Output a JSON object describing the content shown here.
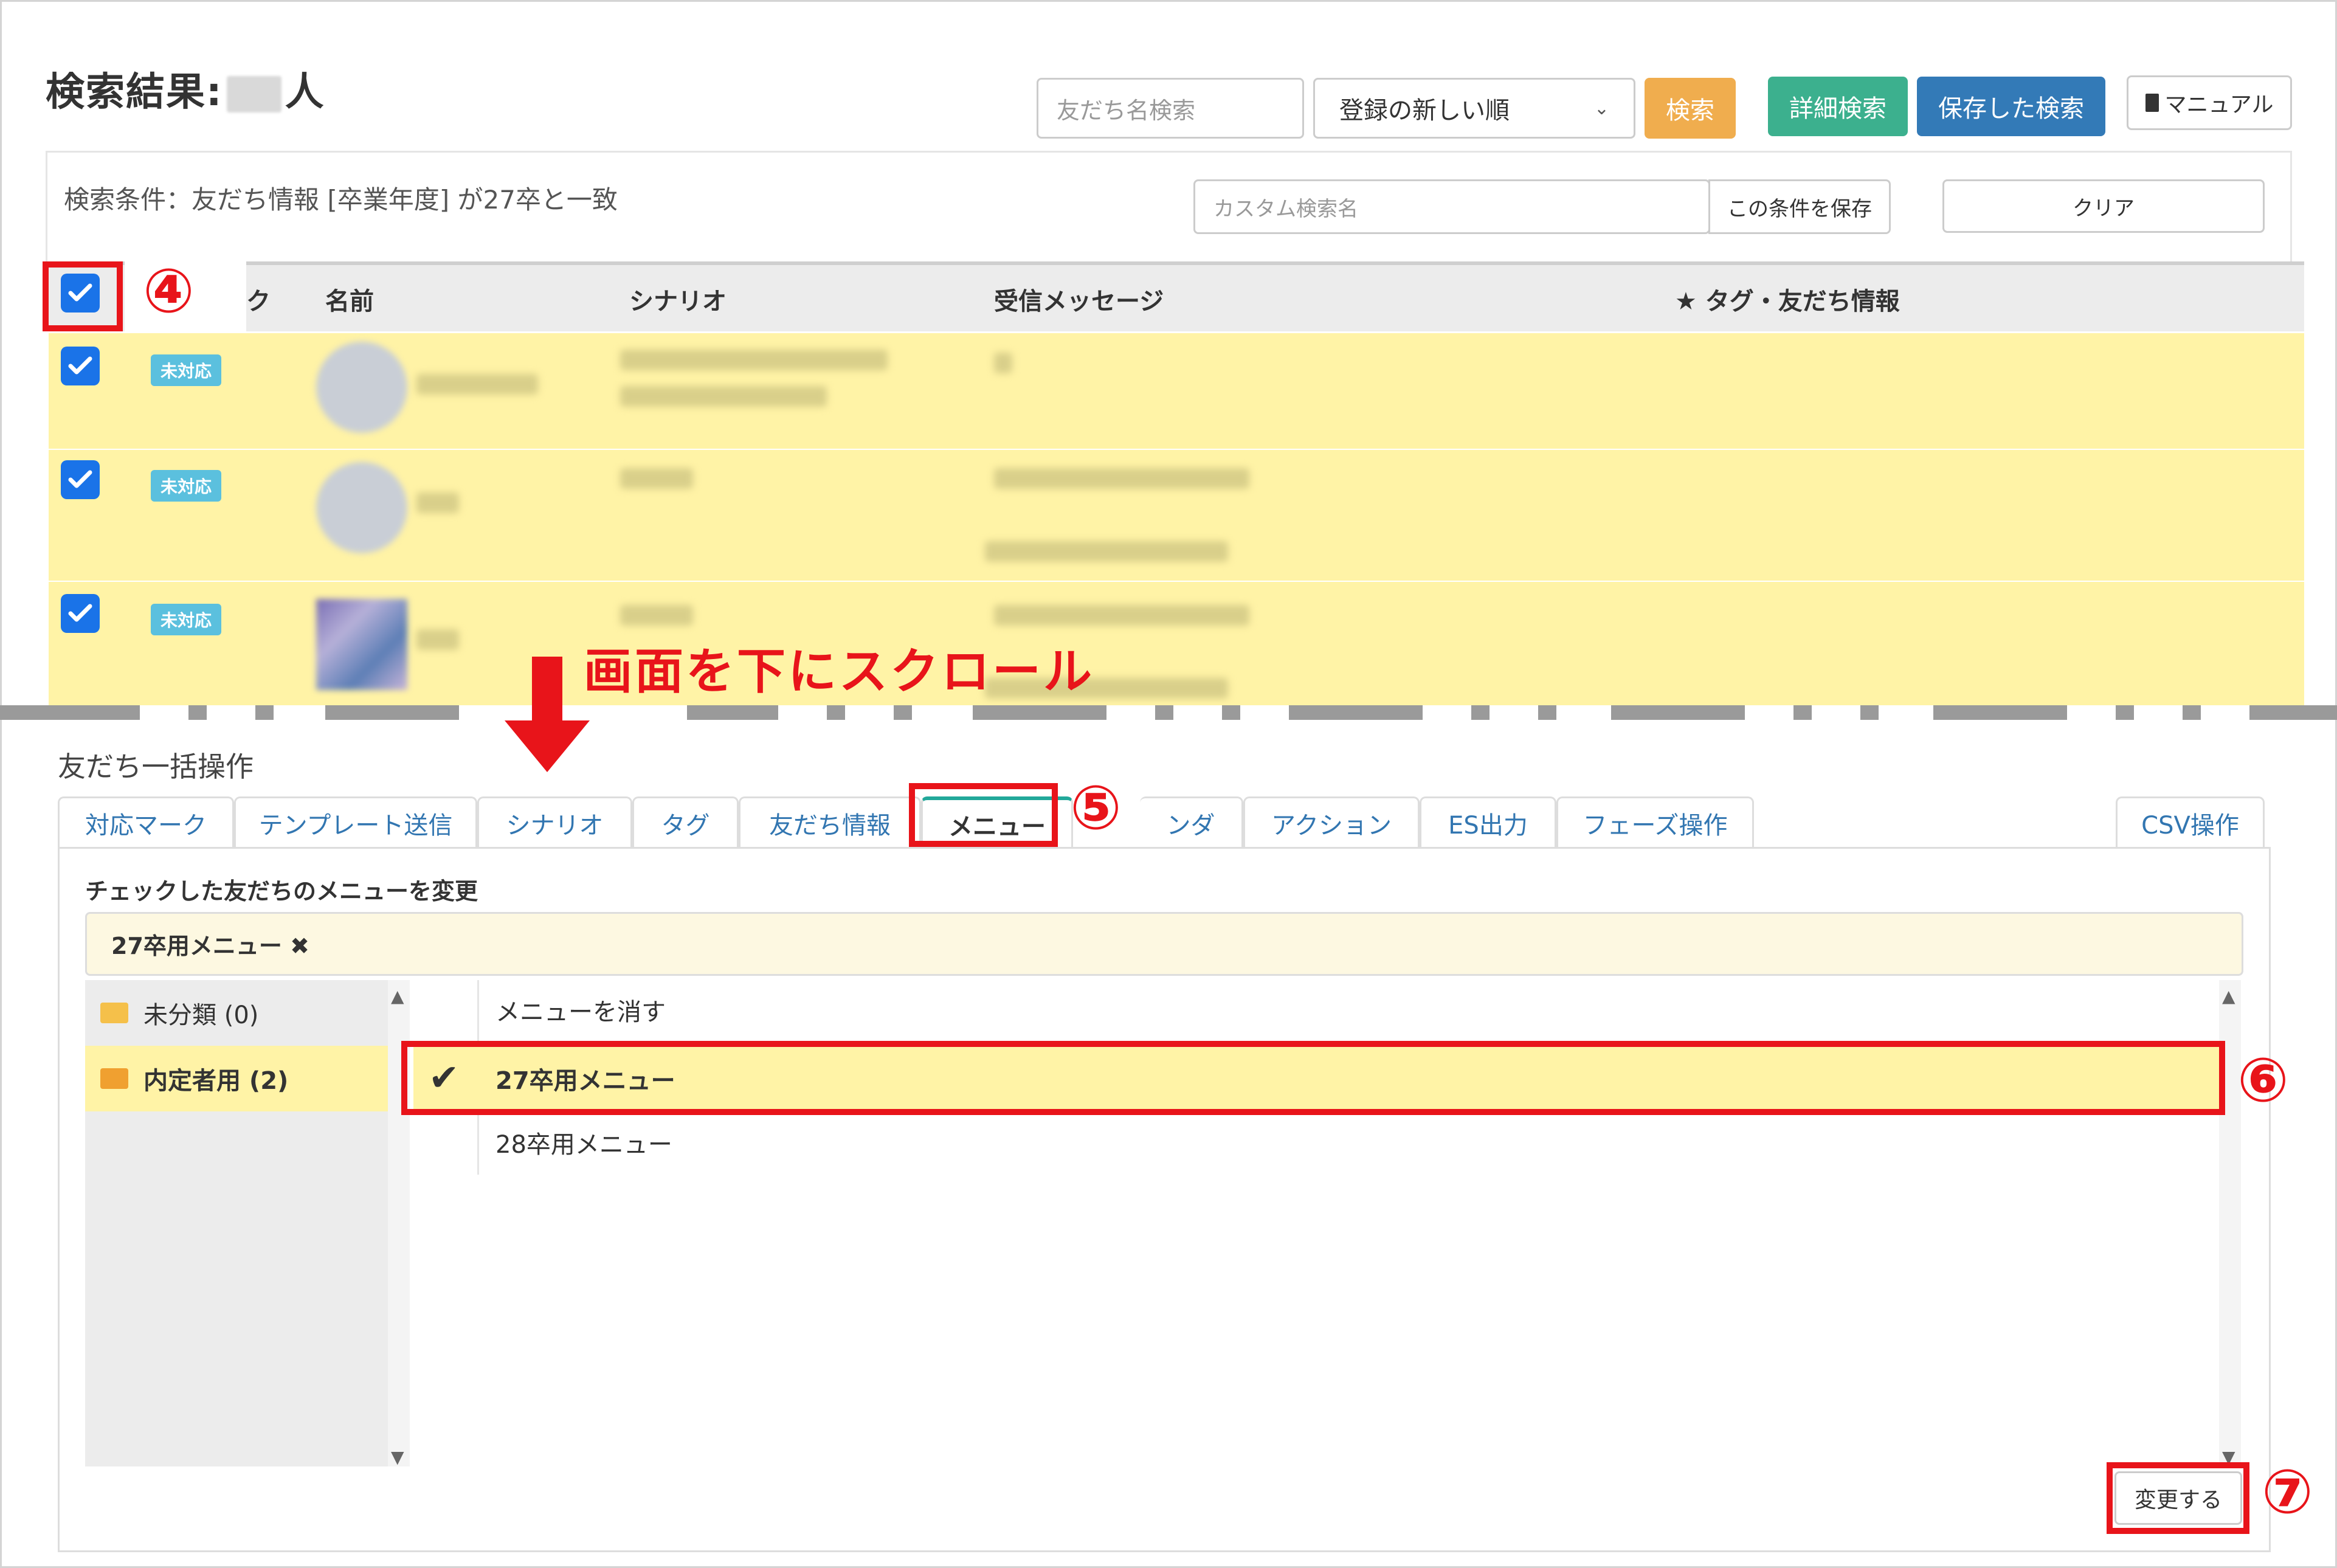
{
  "header": {
    "title": "検索結果:",
    "title_suffix": "人",
    "search_placeholder": "友だち名検索",
    "sort_selected": "登録の新しい順",
    "search_button": "検索",
    "advanced_button": "詳細検索",
    "saved_button": "保存した検索",
    "manual_button": "マニュアル"
  },
  "conditions": {
    "text": "検索条件：友だち情報 [卒業年度] が27卒と一致",
    "custom_name_placeholder": "カスタム検索名",
    "save_button": "この条件を保存",
    "clear_button": "クリア"
  },
  "table": {
    "headers": [
      "ク",
      "名前",
      "シナリオ",
      "受信メッセージ",
      "★ タグ・友だち情報"
    ],
    "rows": [
      {
        "badge": "未対応"
      },
      {
        "badge": "未対応"
      },
      {
        "badge": "未対応"
      }
    ]
  },
  "bulk": {
    "title": "友だち一括操作",
    "tabs": [
      "対応マーク",
      "テンプレート送信",
      "シナリオ",
      "タグ",
      "友だち情報",
      "メニュー",
      "ンダ",
      "アクション",
      "ES出力",
      "フェーズ操作",
      "CSV操作"
    ],
    "panel_label": "チェックした友だちのメニューを変更",
    "selected_menu": "27卒用メニュー ✖",
    "folders": [
      {
        "label": "未分類 (0)"
      },
      {
        "label": "内定者用 (2)"
      }
    ],
    "menu_items": [
      "メニューを消す",
      "27卒用メニュー",
      "28卒用メニュー"
    ],
    "submit_button": "変更する"
  },
  "annotations": {
    "step4": "④",
    "step5": "⑤",
    "step6": "⑥",
    "step7": "⑦",
    "scroll_hint": "画面を下にスクロール"
  },
  "colors": {
    "annotation_red": "#e8141a",
    "row_highlight": "#fff3a6",
    "checkbox_blue": "#1a73e8",
    "tab_active_accent": "#21a89a"
  }
}
